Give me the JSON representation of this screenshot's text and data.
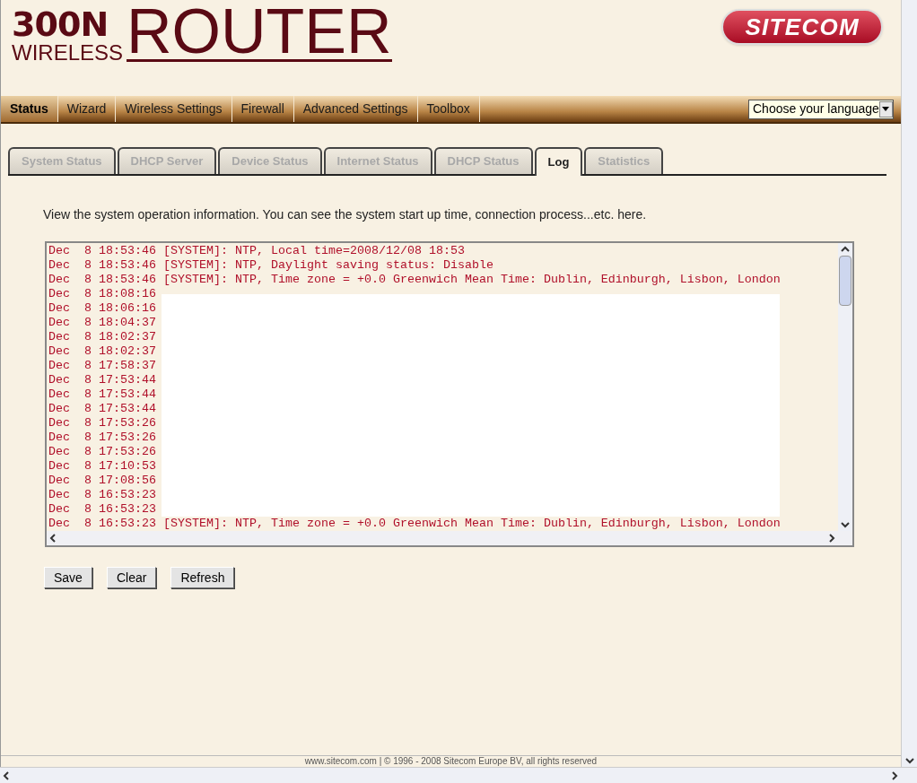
{
  "logo": {
    "line_1": "300N",
    "line_2": "WIRELESS",
    "line_3": "ROUTER"
  },
  "brand": "SITECOM",
  "nav": [
    {
      "label": "Status",
      "selected": true
    },
    {
      "label": "Wizard",
      "selected": false
    },
    {
      "label": "Wireless Settings",
      "selected": false
    },
    {
      "label": "Firewall",
      "selected": false
    },
    {
      "label": "Advanced Settings",
      "selected": false
    },
    {
      "label": "Toolbox",
      "selected": false
    }
  ],
  "language_select": {
    "value": "Choose your language"
  },
  "tabs": [
    {
      "label": "System Status",
      "selected": false
    },
    {
      "label": "DHCP Server",
      "selected": false
    },
    {
      "label": "Device Status",
      "selected": false
    },
    {
      "label": "Internet Status",
      "selected": false
    },
    {
      "label": "DHCP Status",
      "selected": false
    },
    {
      "label": "Log",
      "selected": true
    },
    {
      "label": "Statistics",
      "selected": false
    }
  ],
  "description": "View the system operation information. You can see the system start up time, connection process...etc. here.",
  "log": [
    {
      "time": "Dec  8 18:53:46",
      "message": "[SYSTEM]: NTP, Local time=2008/12/08 18:53"
    },
    {
      "time": "Dec  8 18:53:46",
      "message": "[SYSTEM]: NTP, Daylight saving status: Disable"
    },
    {
      "time": "Dec  8 18:53:46",
      "message": "[SYSTEM]: NTP, Time zone = +0.0 Greenwich Mean Time: Dublin, Edinburgh, Lisbon, London"
    },
    {
      "time": "Dec  8 18:08:16"
    },
    {
      "time": "Dec  8 18:06:16"
    },
    {
      "time": "Dec  8 18:04:37"
    },
    {
      "time": "Dec  8 18:02:37"
    },
    {
      "time": "Dec  8 18:02:37"
    },
    {
      "time": "Dec  8 17:58:37"
    },
    {
      "time": "Dec  8 17:53:44"
    },
    {
      "time": "Dec  8 17:53:44"
    },
    {
      "time": "Dec  8 17:53:44"
    },
    {
      "time": "Dec  8 17:53:26"
    },
    {
      "time": "Dec  8 17:53:26"
    },
    {
      "time": "Dec  8 17:53:26"
    },
    {
      "time": "Dec  8 17:10:53"
    },
    {
      "time": "Dec  8 17:08:56"
    },
    {
      "time": "Dec  8 16:53:23"
    },
    {
      "time": "Dec  8 16:53:23"
    },
    {
      "time": "Dec  8 16:53:23",
      "message": "[SYSTEM]: NTP, Time zone = +0.0 Greenwich Mean Time: Dublin, Edinburgh, Lisbon, London"
    }
  ],
  "buttons": [
    "Save",
    "Clear",
    "Refresh"
  ],
  "footer": "www.sitecom.com | © 1996 - 2008 Sitecom Europe BV, all rights reserved"
}
